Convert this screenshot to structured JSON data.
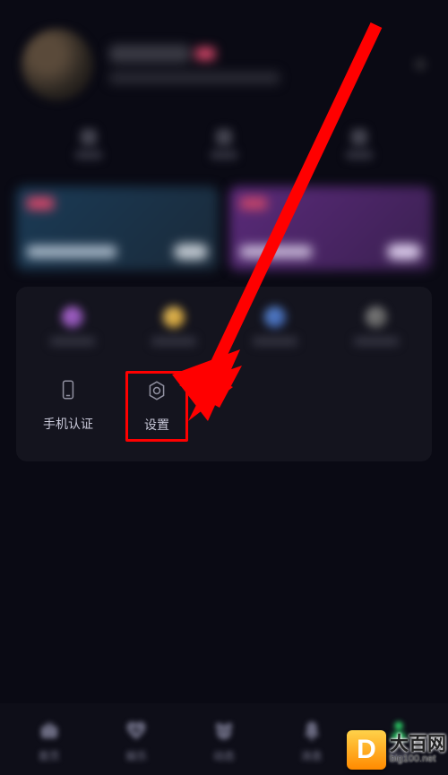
{
  "panel": {
    "phone_auth_label": "手机认证",
    "settings_label": "设置"
  },
  "tabs": {
    "home": "首页",
    "entertainment": "娱乐",
    "feed": "动态",
    "messages": "消息",
    "mine": "我的"
  },
  "watermark": {
    "logo_letter": "D",
    "title": "大百网",
    "sub": "big100.net"
  },
  "annotation": {
    "highlight_color": "#ff0000",
    "arrow_color": "#ff0000"
  }
}
